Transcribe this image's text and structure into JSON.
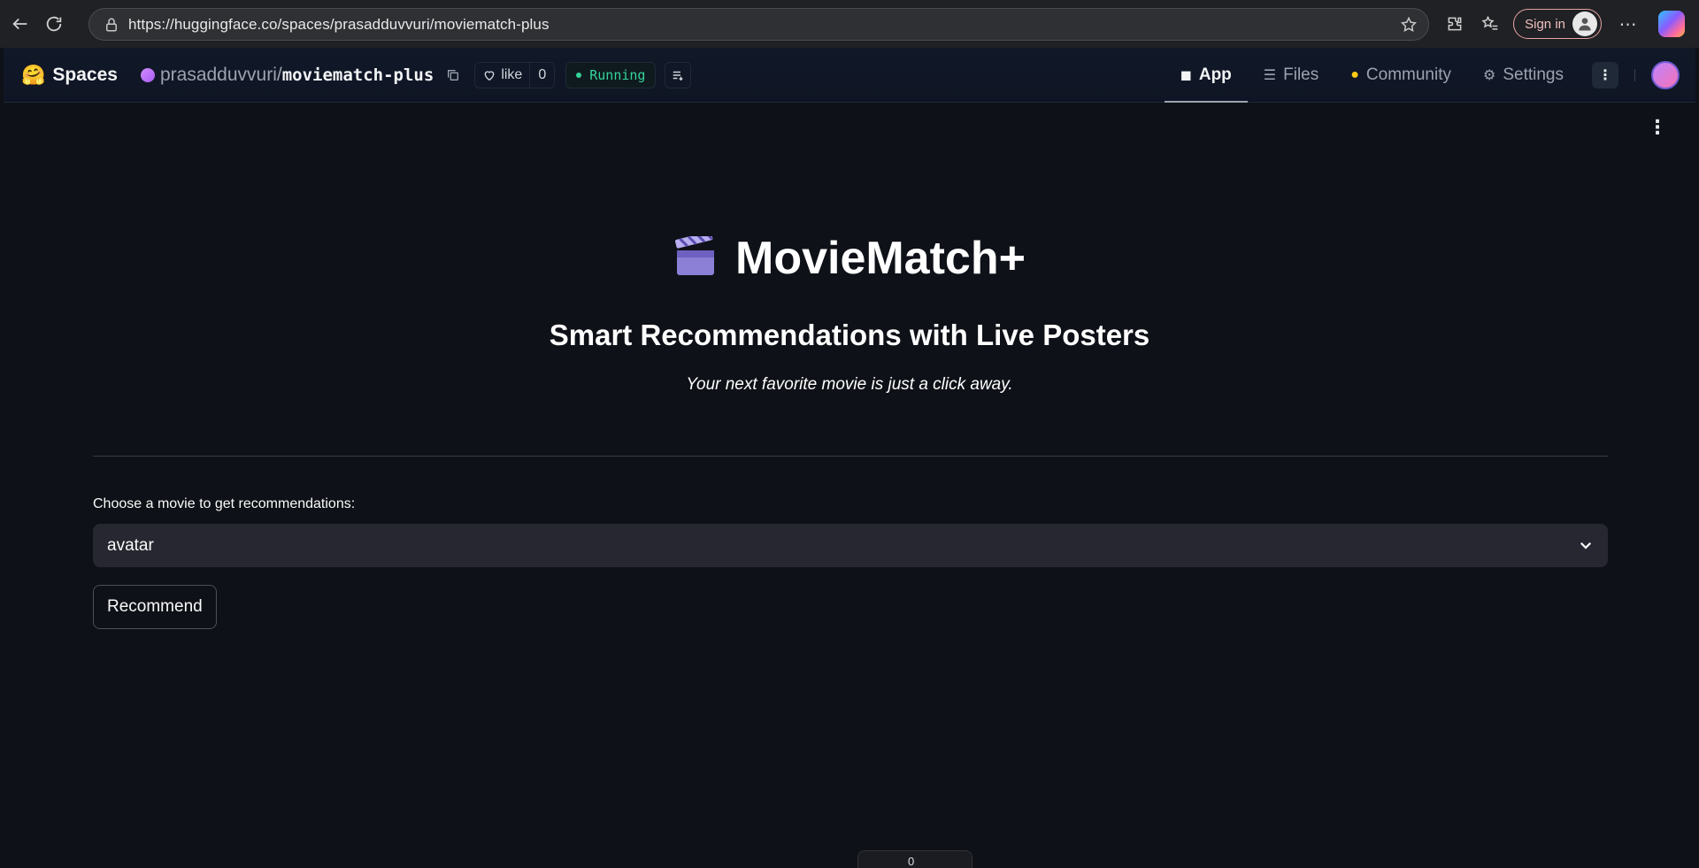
{
  "browser": {
    "url": "https://huggingface.co/spaces/prasadduvvuri/moviematch-plus",
    "sign_in_label": "Sign in"
  },
  "header": {
    "logo_emoji": "🤗",
    "spaces_label": "Spaces",
    "owner": "prasadduvvuri",
    "separator": "/",
    "repo": "moviematch-plus",
    "like_label": "like",
    "like_count": "0",
    "status": "Running",
    "status_color": "#34d399",
    "tabs": [
      {
        "label": "App",
        "icon": "cube-icon",
        "active": true
      },
      {
        "label": "Files",
        "icon": "files-icon",
        "active": false
      },
      {
        "label": "Community",
        "icon": "community-icon",
        "active": false
      },
      {
        "label": "Settings",
        "icon": "gear-icon",
        "active": false
      }
    ]
  },
  "app": {
    "title": "MovieMatch+",
    "title_icon": "clapperboard-icon",
    "subtitle": "Smart Recommendations with Live Posters",
    "tagline": "Your next favorite movie is just a click away.",
    "select_label": "Choose a movie to get recommendations:",
    "selected_movie": "avatar",
    "recommend_label": "Recommend",
    "footer_value": "0"
  }
}
